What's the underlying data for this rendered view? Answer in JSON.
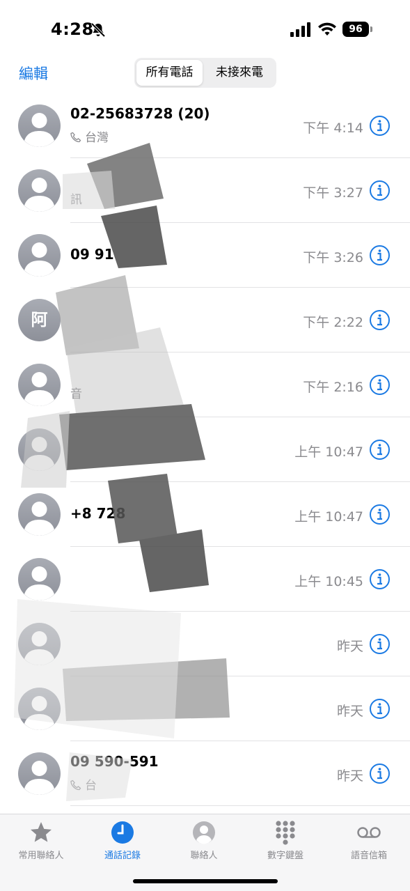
{
  "status_bar": {
    "time": "4:28",
    "battery": "96",
    "icons": [
      "bell-slash-icon",
      "signal-icon",
      "wifi-icon",
      "battery-icon"
    ]
  },
  "header": {
    "edit_label": "編輯",
    "segments": [
      "所有電話",
      "未接來電"
    ],
    "selected_segment": "所有電話"
  },
  "calls": [
    {
      "name": "02-25683728 (20)",
      "subtitle": "台灣",
      "time": "下午 4:14",
      "avatar": "person"
    },
    {
      "name": "",
      "subtitle": "訊",
      "time": "下午 3:27",
      "avatar": "person"
    },
    {
      "name": "09      91",
      "subtitle": "",
      "time": "下午 3:26",
      "avatar": "person"
    },
    {
      "name": "",
      "subtitle": "",
      "time": "下午 2:22",
      "avatar": "阿"
    },
    {
      "name": "",
      "subtitle": "音",
      "time": "下午 2:16",
      "avatar": "person"
    },
    {
      "name": "",
      "subtitle": "",
      "time": "上午 10:47",
      "avatar": "person"
    },
    {
      "name": "+8        728",
      "subtitle": "",
      "time": "上午 10:47",
      "avatar": "person"
    },
    {
      "name": "",
      "subtitle": "",
      "time": "上午 10:45",
      "avatar": "person"
    },
    {
      "name": "",
      "subtitle": "",
      "time": "昨天",
      "avatar": "person"
    },
    {
      "name": "",
      "subtitle": "",
      "time": "昨天",
      "avatar": "person"
    },
    {
      "name": "09    590-591",
      "subtitle": "台",
      "time": "昨天",
      "avatar": "person"
    }
  ],
  "tab_bar": {
    "tabs": [
      {
        "label": "常用聯絡人",
        "icon": "star-icon"
      },
      {
        "label": "通話記錄",
        "icon": "clock-icon"
      },
      {
        "label": "聯絡人",
        "icon": "person-circle-icon"
      },
      {
        "label": "數字鍵盤",
        "icon": "keypad-icon"
      },
      {
        "label": "語音信箱",
        "icon": "voicemail-icon"
      }
    ],
    "active": "通話記錄"
  },
  "colors": {
    "accent": "#1b7ae3",
    "secondary_text": "#8a8a8e",
    "avatar": "#9a9da5"
  }
}
